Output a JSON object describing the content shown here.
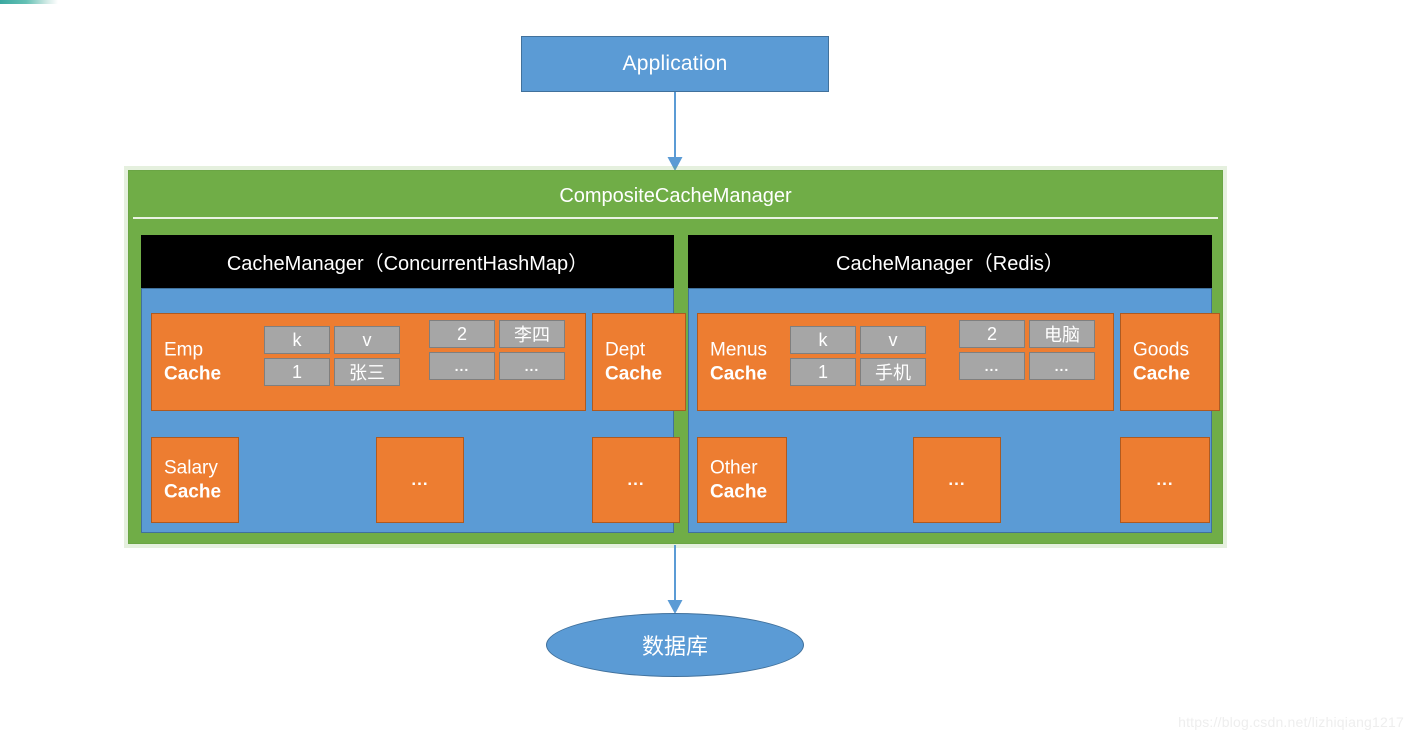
{
  "diagram": {
    "title": "CompositeCacheManager cache architecture",
    "colors": {
      "blue": "#5B9BD5",
      "blue_border": "#41719C",
      "green": "#70AD47",
      "orange": "#ED7D31",
      "orange_border": "#AE5A21",
      "black": "#000000",
      "gray_cell": "#A6A6A6",
      "gray_cell_border": "#7F7F7F",
      "white_text": "#FFFFFF"
    }
  },
  "application": {
    "label": "Application"
  },
  "arrows": {
    "app_to_manager": "arrow-down-icon",
    "manager_to_database": "arrow-down-icon"
  },
  "composite": {
    "title": "CompositeCacheManager"
  },
  "managers": [
    {
      "id": "concurrent-hash-map",
      "header": "CacheManager（ConcurrentHashMap）",
      "caches": [
        {
          "id": "emp-cache",
          "line1": "Emp",
          "line2": "Cache",
          "tables": [
            {
              "id": "emp-table-1",
              "rows": [
                [
                  "k",
                  "v"
                ],
                [
                  "1",
                  "张三"
                ]
              ]
            },
            {
              "id": "emp-table-2",
              "rows": [
                [
                  "2",
                  "李四"
                ],
                [
                  "...",
                  "..."
                ]
              ]
            }
          ]
        },
        {
          "id": "dept-cache",
          "line1": "Dept",
          "line2": "Cache",
          "tables": []
        },
        {
          "id": "salary-cache",
          "line1": "Salary",
          "line2": "Cache",
          "tables": []
        }
      ],
      "placeholders": [
        {
          "id": "cchm-placeholder-1",
          "label": "..."
        },
        {
          "id": "cchm-placeholder-2",
          "label": "..."
        }
      ]
    },
    {
      "id": "redis",
      "header": "CacheManager（Redis）",
      "caches": [
        {
          "id": "menus-cache",
          "line1": "Menus",
          "line2": "Cache",
          "tables": [
            {
              "id": "menus-table-1",
              "rows": [
                [
                  "k",
                  "v"
                ],
                [
                  "1",
                  "手机"
                ]
              ]
            },
            {
              "id": "menus-table-2",
              "rows": [
                [
                  "2",
                  "电脑"
                ],
                [
                  "...",
                  "..."
                ]
              ]
            }
          ]
        },
        {
          "id": "goods-cache",
          "line1": "Goods",
          "line2": "Cache",
          "tables": []
        },
        {
          "id": "other-cache",
          "line1": "Other",
          "line2": "Cache",
          "tables": []
        }
      ],
      "placeholders": [
        {
          "id": "redis-placeholder-1",
          "label": "..."
        },
        {
          "id": "redis-placeholder-2",
          "label": "..."
        }
      ]
    }
  ],
  "database": {
    "label": "数据库"
  },
  "watermark": {
    "text": "https://blog.csdn.net/lizhiqiang1217"
  }
}
